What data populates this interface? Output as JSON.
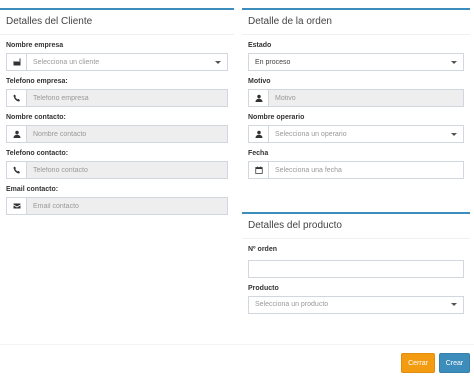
{
  "cliente": {
    "title": "Detalles del Cliente",
    "nombre_empresa": {
      "label": "Nombre empresa",
      "placeholder": "Selecciona un cliente",
      "icon": "industry-icon"
    },
    "telefono_empresa": {
      "label": "Telefono empresa:",
      "placeholder": "Telefono empresa",
      "icon": "phone-icon"
    },
    "nombre_contacto": {
      "label": "Nombre contacto:",
      "placeholder": "Nombre contacto",
      "icon": "user-icon"
    },
    "telefono_contacto": {
      "label": "Telefono contacto:",
      "placeholder": "Telefono contacto",
      "icon": "phone-icon"
    },
    "email_contacto": {
      "label": "Email contacto:",
      "placeholder": "Email contacto",
      "icon": "envelope-icon"
    }
  },
  "orden": {
    "title": "Detalle de la orden",
    "estado": {
      "label": "Estado",
      "value": "En proceso"
    },
    "motivo": {
      "label": "Motivo",
      "placeholder": "Motivo",
      "icon": "user-icon"
    },
    "operario": {
      "label": "Nombre operario",
      "placeholder": "Selecciona un operario",
      "icon": "user-icon"
    },
    "fecha": {
      "label": "Fecha",
      "placeholder": "Selecciona una fecha",
      "icon": "calendar-icon"
    }
  },
  "producto": {
    "title": "Detalles del producto",
    "n_orden": {
      "label": "Nº orden",
      "value": ""
    },
    "producto": {
      "label": "Producto",
      "placeholder": "Selecciona un producto"
    }
  },
  "buttons": {
    "cerrar": "Cerrar",
    "crear": "Crear"
  },
  "colors": {
    "primary": "#3c8dbc",
    "warning": "#f39c12"
  }
}
